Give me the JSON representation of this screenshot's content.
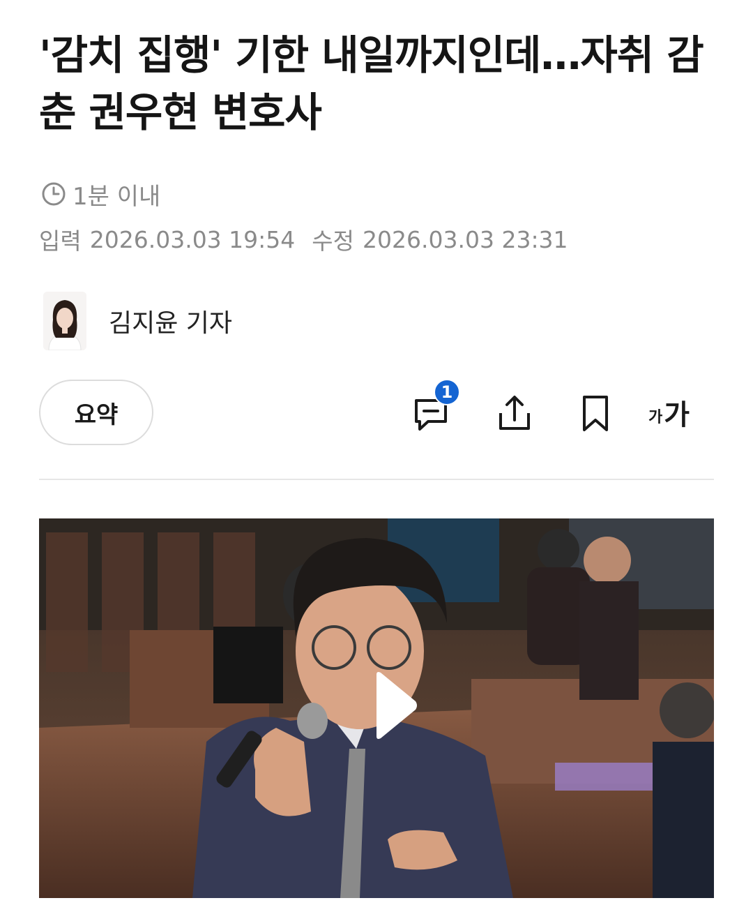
{
  "article": {
    "headline": "'감치 집행' 기한 내일까지인데…자취 감춘 권우현 변호사",
    "read_time": "1분 이내",
    "input_label": "입력",
    "input_datetime": "2026.03.03 19:54",
    "modified_label": "수정",
    "modified_datetime": "2026.03.03 23:31",
    "reporter": "김지윤 기자"
  },
  "toolbar": {
    "summary_label": "요약",
    "comment_count": "1",
    "font_small": "가",
    "font_big": "가"
  },
  "icons": [
    "clock-icon",
    "comment-icon",
    "share-icon",
    "bookmark-icon",
    "font-size-icon",
    "play-icon"
  ],
  "colors": {
    "badge": "#1464d2",
    "meta_text": "#8a8a8a",
    "headline": "#151515"
  }
}
